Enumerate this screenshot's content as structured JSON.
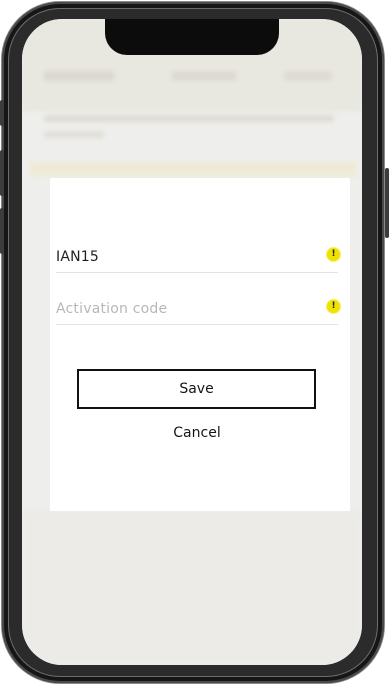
{
  "dialog": {
    "fields": [
      {
        "value": "IAN15",
        "placeholder": "",
        "icon": "info-icon",
        "icon_color": "#f0e200"
      },
      {
        "value": "",
        "placeholder": "Activation code",
        "icon": "info-icon",
        "icon_color": "#f0e200"
      }
    ],
    "save_label": "Save",
    "cancel_label": "Cancel"
  },
  "colors": {
    "accent": "#f0e200",
    "button_border": "#111111",
    "dialog_background": "#ffffff"
  }
}
